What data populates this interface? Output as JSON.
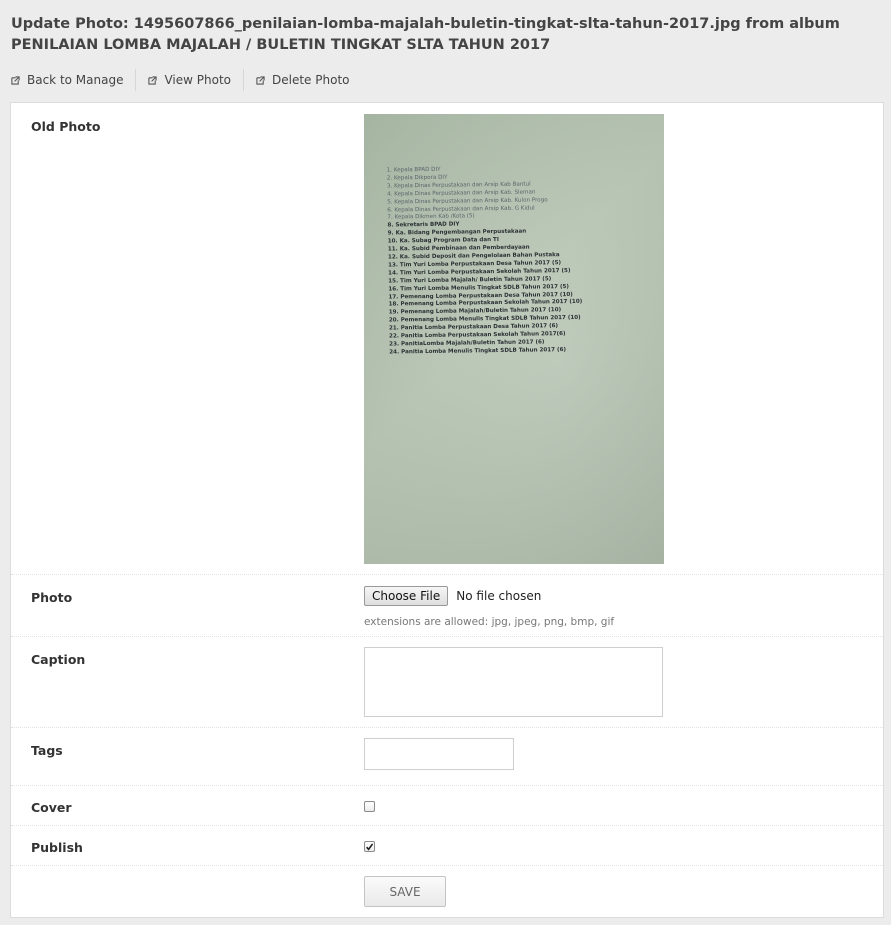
{
  "page": {
    "title": "Update Photo: 1495607866_penilaian-lomba-majalah-buletin-tingkat-slta-tahun-2017.jpg from album PENILAIAN LOMBA MAJALAH / BULETIN TINGKAT SLTA TAHUN 2017"
  },
  "toolbar": {
    "back": "Back to Manage",
    "view": "View Photo",
    "delete": "Delete Photo"
  },
  "form": {
    "old_photo_label": "Old Photo",
    "photo_label": "Photo",
    "choose_file": "Choose File",
    "no_file": "No file chosen",
    "extensions_hint": "extensions are allowed: jpg, jpeg, png, bmp, gif",
    "caption_label": "Caption",
    "caption_value": "",
    "tags_label": "Tags",
    "tags_value": "",
    "cover_label": "Cover",
    "cover_checked": false,
    "publish_label": "Publish",
    "publish_checked": true,
    "save_label": "SAVE"
  },
  "photo_text": [
    "1.  Kepala BPAD DIY",
    "2.  Kepala Dikpora DIY",
    "3.  Kepala Dinas Perpustakaan dan Arsip Kab Bantul",
    "4.  Kepala Dinas Perpustakaan dan Arsip Kab. Sleman",
    "5.  Kepala Dinas Perpustakaan dan Arsip Kab. Kulon Progo",
    "6.  Kepala Dinas Perpustakaan dan Arsip Kab. G Kidul",
    "7.  Kepala Dikmen Kab /Kota (5)",
    "8.  Sekretaris BPAD DIY",
    "9.  Ka. Bidang Pengembangan Perpustakaan",
    "10. Ka. Subag Program Data dan TI",
    "11. Ka. Subid Pembinaan dan Pemberdayaan",
    "12. Ka. Subid Deposit dan Pengelolaan Bahan Pustaka",
    "13. Tim Yuri Lomba Perpustakaan Desa Tahun 2017 (5)",
    "14. Tim Yuri Lomba Perpustakaan Sekolah Tahun 2017 (5)",
    "15. Tim Yuri Lomba Majalah/ Buletin Tahun 2017 (5)",
    "16. Tim Yuri Lomba Menulis Tingkat SDLB Tahun 2017 (5)",
    "17. Pemenang  Lomba Perpustakaan Desa Tahun 2017 (10)",
    "18. Pemenang  Lomba Perpustakaan Sekolah Tahun 2017 (10)",
    "19. Pemenang Lomba Majalah/Buletin Tahun 2017 (10)",
    "20. Pemenang Lomba Menulis Tingkat SDLB Tahun 2017 (10)",
    "21. Panitia Lomba Perpustakaan Desa Tahun 2017 (6)",
    "22. Panitia Lomba Perpustakaan Sekolah Tahun 2017(6)",
    "23. PanitiaLomba Majalah/Buletin Tahun 2017 (6)",
    "24. Panitia Lomba Menulis Tingkat SDLB Tahun 2017 (6)"
  ]
}
